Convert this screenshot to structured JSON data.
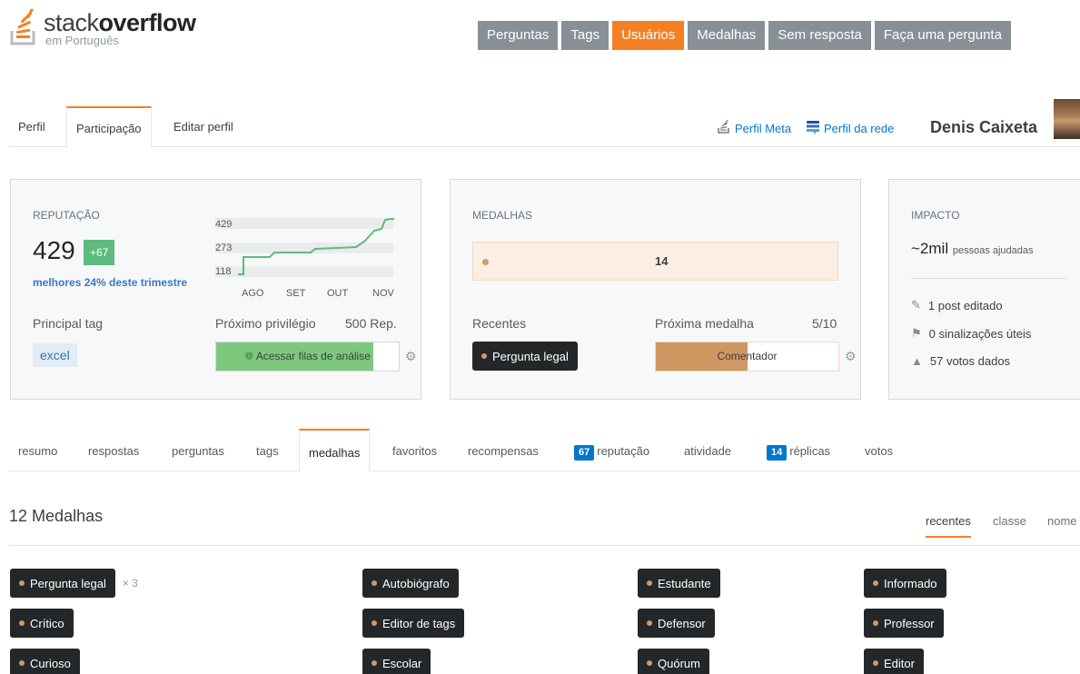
{
  "header": {
    "logo_main_light": "stack",
    "logo_main_bold": "overflow",
    "logo_sub": "em Português",
    "nav": [
      {
        "label": "Perguntas",
        "active": false
      },
      {
        "label": "Tags",
        "active": false
      },
      {
        "label": "Usuários",
        "active": true
      },
      {
        "label": "Medalhas",
        "active": false
      },
      {
        "label": "Sem resposta",
        "active": false
      },
      {
        "label": "Faça uma pergunta",
        "active": false
      }
    ]
  },
  "profile": {
    "tabs": [
      "Perfil",
      "Participação",
      "Editar perfil"
    ],
    "active_tab": "Participação",
    "meta_link": "Perfil Meta",
    "network_link": "Perfil da rede",
    "user_name": "Denis Caixeta"
  },
  "reputation": {
    "title": "REPUTAÇÃO",
    "value": "429",
    "delta": "+67",
    "rank": "melhores 24% deste trimestre",
    "graph_ticks": [
      "429",
      "273",
      "118"
    ],
    "graph_months": [
      "AGO",
      "SET",
      "OUT",
      "NOV"
    ],
    "top_tag_label": "Principal tag",
    "top_tag": "excel",
    "next_priv_label": "Próximo privilégio",
    "next_priv_rep": "500 Rep.",
    "next_priv_action": "Acessar filas de análise",
    "next_priv_progress": 0.86
  },
  "medals_card": {
    "title": "MEDALHAS",
    "bronze_count": "14",
    "recent_label": "Recentes",
    "recent_badge": "Pergunta legal",
    "next_label": "Próxima medalha",
    "next_progress_text": "5/10",
    "next_badge": "Comentador",
    "next_progress": 0.5
  },
  "impact": {
    "title": "IMPACTO",
    "people": "~2mil",
    "people_label": "pessoas ajudadas",
    "posts_edited": "1 post editado",
    "flags": "0 sinalizações úteis",
    "votes": "57 votos dados"
  },
  "subtabs": {
    "items": [
      {
        "label": "resumo",
        "count": ""
      },
      {
        "label": "respostas",
        "count": ""
      },
      {
        "label": "perguntas",
        "count": ""
      },
      {
        "label": "tags",
        "count": ""
      },
      {
        "label": "medalhas",
        "count": ""
      },
      {
        "label": "favoritos",
        "count": ""
      },
      {
        "label": "recompensas",
        "count": ""
      },
      {
        "label": "reputação",
        "count": "67"
      },
      {
        "label": "atividade",
        "count": ""
      },
      {
        "label": "réplicas",
        "count": "14"
      },
      {
        "label": "votos",
        "count": ""
      }
    ],
    "active": "medalhas"
  },
  "badges_section": {
    "count": "12",
    "title": "Medalhas",
    "sort": [
      "recentes",
      "classe",
      "nome"
    ],
    "sort_active": "recentes",
    "items": [
      {
        "label": "Pergunta legal",
        "multiplier": "× 3"
      },
      {
        "label": "Autobiógrafo",
        "multiplier": ""
      },
      {
        "label": "Estudante",
        "multiplier": ""
      },
      {
        "label": "Informado",
        "multiplier": ""
      },
      {
        "label": "Crítico",
        "multiplier": ""
      },
      {
        "label": "Editor de tags",
        "multiplier": ""
      },
      {
        "label": "Defensor",
        "multiplier": ""
      },
      {
        "label": "Professor",
        "multiplier": ""
      },
      {
        "label": "Curioso",
        "multiplier": ""
      },
      {
        "label": "Escolar",
        "multiplier": ""
      },
      {
        "label": "Quórum",
        "multiplier": ""
      },
      {
        "label": "Editor",
        "multiplier": ""
      }
    ]
  },
  "colors": {
    "accent": "#f48024",
    "link": "#0077cc",
    "bronze": "#cd9a6b",
    "success": "#5eba7d"
  }
}
